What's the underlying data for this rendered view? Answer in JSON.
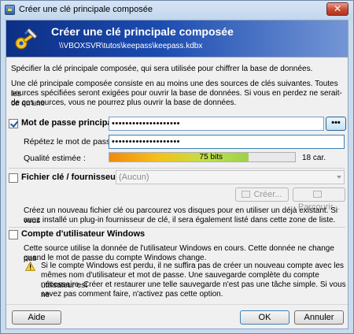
{
  "window": {
    "title": "Créer une clé principale composée",
    "close_glyph": "✕"
  },
  "banner": {
    "heading": "Créer une clé principale composée",
    "subheading": "\\\\VBOXSVR\\tutos\\keepass\\keepass.kdbx",
    "icon": "key-pen-icon"
  },
  "intro": {
    "line1": "Spécifier la clé principale composée, qui sera utilisée pour chiffrer la base de données.",
    "para_line1": "Une clé principale composée consiste en au moins une des sources de clés suivantes. Toutes les",
    "para_line2": "sources spécifiées seront exigées pour ouvrir la base de données. Si vous en perdez ne serait-ce qu'une",
    "para_line3": "de ces sources, vous ne pourrez plus ouvrir la base de données."
  },
  "password": {
    "checkbox_label": "Mot de passe principal :",
    "checked": true,
    "value": "••••••••••••••••••••",
    "toggle_label": "•••",
    "repeat_label": "Répétez le mot de passe :",
    "repeat_value": "••••••••••••••••••••",
    "quality_label": "Qualité estimée :",
    "quality_bits": "75 bits",
    "quality_fraction": 0.75,
    "char_count": "18 car."
  },
  "keyfile": {
    "checkbox_label": "Fichier clé / fournisseur :",
    "checked": false,
    "selected": "(Aucun)",
    "create_label": "Créer...",
    "browse_label": "Parcourir...",
    "desc_line1": "Créez un nouveau fichier clé ou parcourez vos disques pour en utiliser un déjà existant. Si vous",
    "desc_line2": "avez installé un plug-in fournisseur de clé, il sera également listé dans cette zone de liste."
  },
  "winaccount": {
    "checkbox_label": "Compte d'utilisateur Windows",
    "checked": false,
    "desc_line1": "Cette source utilise la donnée de l'utilisateur Windows en cours. Cette donnée ne change pas",
    "desc_line2": "quand le mot de passe du compte Windows change.",
    "warn_line1": "Si le compte Windows est perdu, il ne suffira pas de créer un nouveau compte avec les",
    "warn_line2": "mêmes nom d'utilisateur et mot de passe.  Une sauvegarde complète du compte utilisateur est",
    "warn_line3": "nécessaire. Créer et restaurer une telle sauvegarde n'est pas une tâche simple. Si vous ne",
    "warn_line4": "savez pas comment faire, n'activez pas cette option."
  },
  "footer": {
    "help_label": "Aide",
    "ok_label": "OK",
    "cancel_label": "Annuler"
  }
}
